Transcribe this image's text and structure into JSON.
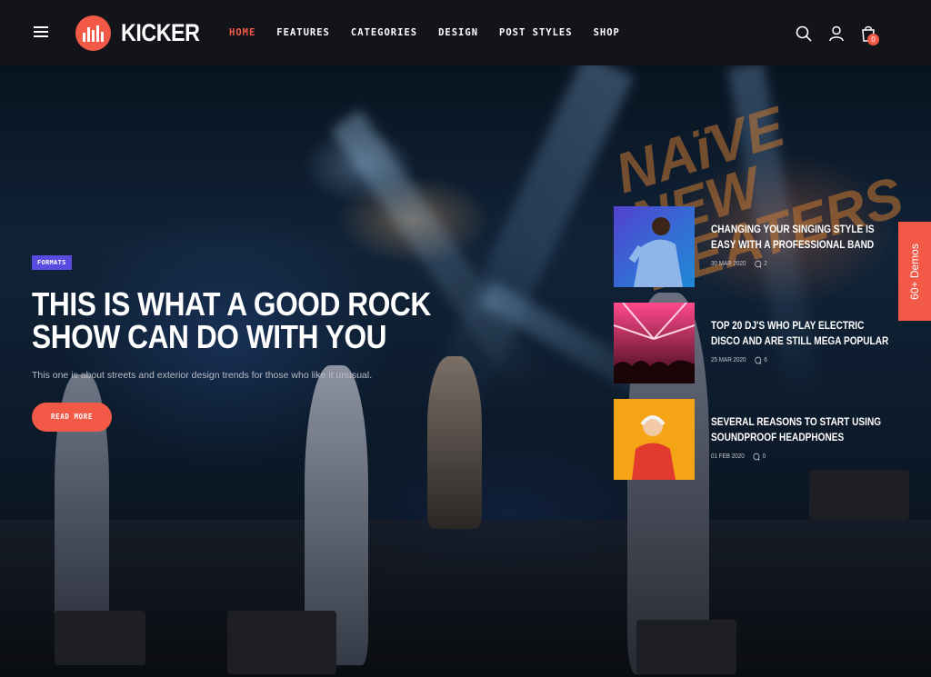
{
  "header": {
    "logo_text": "KICKER",
    "nav": [
      {
        "label": "HOME",
        "active": true
      },
      {
        "label": "FEATURES",
        "active": false
      },
      {
        "label": "CATEGORIES",
        "active": false
      },
      {
        "label": "DESIGN",
        "active": false
      },
      {
        "label": "POST STYLES",
        "active": false
      },
      {
        "label": "SHOP",
        "active": false
      }
    ],
    "cart_count": "0",
    "icons": [
      "menu-icon",
      "search-icon",
      "user-icon",
      "shopping-bag-icon"
    ]
  },
  "hero": {
    "tag": "FORMATS",
    "title": "THIS IS WHAT A GOOD ROCK SHOW CAN DO WITH YOU",
    "excerpt": "This one is about streets and exterior design trends for those who like it unusual.",
    "button": "READ MORE",
    "background_text": "NAïVE NEW BEATERS"
  },
  "posts": [
    {
      "title": "CHANGING YOUR SINGING STYLE IS EASY WITH A PROFESSIONAL BAND",
      "date": "30 MAR 2020",
      "comments": "2"
    },
    {
      "title": "TOP 20 DJ'S WHO PLAY ELECTRIC DISCO AND ARE STILL MEGA POPULAR",
      "date": "25 MAR 2020",
      "comments": "6"
    },
    {
      "title": "SEVERAL REASONS TO START USING SOUNDPROOF HEADPHONES",
      "date": "01 FEB 2020",
      "comments": "0"
    }
  ],
  "demos_label": "60+ Demos",
  "colors": {
    "accent": "#f25a47",
    "tag": "#5a4ce0",
    "header_bg": "#121419"
  }
}
